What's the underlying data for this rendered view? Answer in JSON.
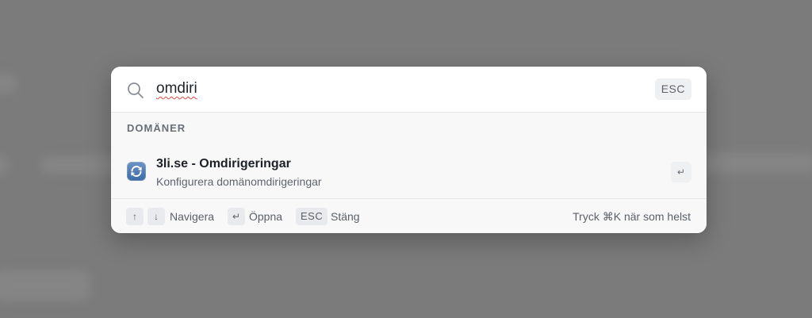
{
  "search": {
    "value": "omdiri",
    "esc_label": "ESC"
  },
  "section": {
    "title": "DOMÄNER"
  },
  "result": {
    "icon": "sync-icon",
    "title": "3li.se - Omdirigeringar",
    "subtitle": "Konfigurera domänomdirigeringar",
    "enter_key": "↵"
  },
  "footer": {
    "up_key": "↑",
    "down_key": "↓",
    "navigate_label": "Navigera",
    "enter_key": "↵",
    "open_label": "Öppna",
    "esc_key": "ESC",
    "close_label": "Stäng",
    "shortcut_hint": "Tryck ⌘K när som helst"
  },
  "colors": {
    "overlay": "#7b7b7b",
    "panel": "#f8f8f9",
    "icon_blue": "#3c6aa6",
    "spell_underline": "#e0483d"
  }
}
